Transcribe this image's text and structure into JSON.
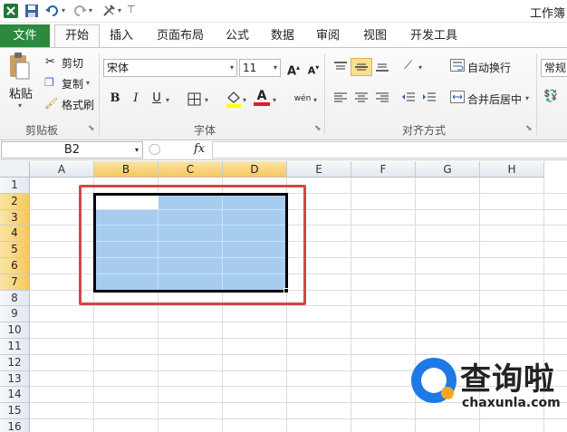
{
  "titlebar": {
    "title": "工作簿"
  },
  "tabs": [
    {
      "label": "文件"
    },
    {
      "label": "开始"
    },
    {
      "label": "插入"
    },
    {
      "label": "页面布局"
    },
    {
      "label": "公式"
    },
    {
      "label": "数据"
    },
    {
      "label": "审阅"
    },
    {
      "label": "视图"
    },
    {
      "label": "开发工具"
    }
  ],
  "clipboard": {
    "paste": "粘贴",
    "cut": "剪切",
    "copy": "复制",
    "format_painter": "格式刷",
    "group": "剪贴板"
  },
  "font": {
    "name": "宋体",
    "size": "11",
    "bold": "B",
    "italic": "I",
    "underline": "U",
    "grow": "A",
    "shrink": "A",
    "font_color": "A",
    "phonetic": "wén",
    "group": "字体"
  },
  "alignment": {
    "wrap_text": "自动换行",
    "merge_center": "合并后居中",
    "group": "对齐方式"
  },
  "number": {
    "format": "常规"
  },
  "formula_bar": {
    "name_box": "B2",
    "fx": "fx"
  },
  "columns": [
    "A",
    "B",
    "C",
    "D",
    "E",
    "F",
    "G",
    "H"
  ],
  "rows": [
    "1",
    "2",
    "3",
    "4",
    "5",
    "6",
    "7",
    "8",
    "9",
    "10",
    "11",
    "12",
    "13",
    "14",
    "15",
    "16"
  ],
  "selected_columns": [
    "B",
    "C",
    "D"
  ],
  "selected_rows": [
    "2",
    "3",
    "4",
    "5",
    "6",
    "7"
  ],
  "watermark": {
    "brand_cn": "查询啦",
    "brand_en": "chaxunla.com"
  },
  "colors": {
    "file_tab": "#2c8a3e",
    "selection_fill": "#a6cdee",
    "header_highlight": "#f6c85e",
    "annotation_box": "#d14848",
    "watermark_blue": "#1e78e6",
    "watermark_orange": "#f5a623"
  }
}
